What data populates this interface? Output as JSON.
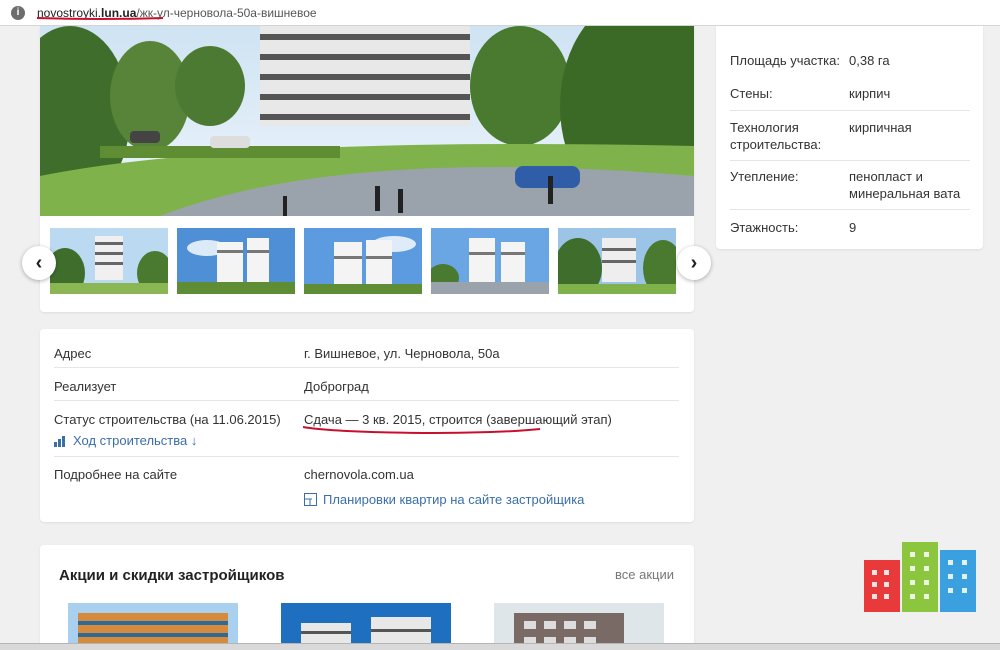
{
  "browser": {
    "url_host_prefix": "novostroyki.",
    "url_host_bold": "lun.ua",
    "url_path": "/жк-ул-черновола-50а-вишневое",
    "icon": "info-icon"
  },
  "gallery": {
    "prev_glyph": "‹",
    "next_glyph": "›",
    "thumb_count": 5
  },
  "specs": [
    {
      "label": "Площадь участка:",
      "value": "0,38 га"
    },
    {
      "label": "Стены:",
      "value": "кирпич"
    },
    {
      "label": "Технология строительства:",
      "value": "кирпичная"
    },
    {
      "label": "Утепление:",
      "value": "пенопласт и минеральная вата"
    },
    {
      "label": "Этажность:",
      "value": "9"
    }
  ],
  "info": {
    "address_label": "Адрес",
    "address_value": "г. Вишневое, ул. Черновола, 50а",
    "developer_label": "Реализует",
    "developer_value": "Доброград",
    "status_label": "Статус строительства (на 11.06.2015)",
    "status_value": "Сдача — 3 кв. 2015, строится (завершающий этап)",
    "progress_link": "Ход строительства ↓",
    "site_label": "Подробнее на сайте",
    "site_value": "chernovola.com.ua",
    "plans_link": "Планировки квартир на сайте застройщика"
  },
  "promos": {
    "title": "Акции и скидки застройщиков",
    "all_link": "все акции"
  },
  "colors": {
    "link": "#3a6eaa",
    "annotation_red": "#c8102e",
    "logo_red": "#e8393b",
    "logo_green": "#8cc63f",
    "logo_blue": "#3aa0e0"
  }
}
